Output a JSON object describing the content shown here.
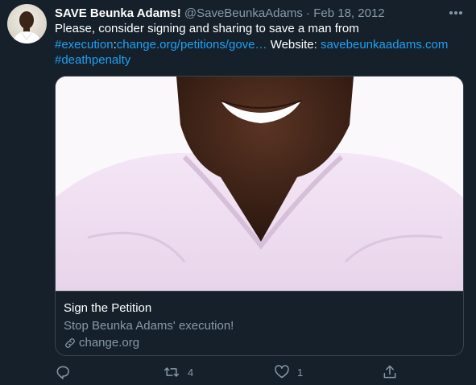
{
  "tweet": {
    "display_name": "SAVE Beunka Adams!",
    "handle": "@SaveBeunkaAdams",
    "separator": "·",
    "date": "Feb 18, 2012",
    "text_part1": "Please, consider signing and sharing to save a man from",
    "hashtag_execution": "#execution",
    "colon": ":",
    "petition_link": "change.org/petitions/gove…",
    "website_label": " Website: ",
    "website_link": "savebeunkaadams.com",
    "hashtag_deathpenalty": "#deathpenalty"
  },
  "card": {
    "title": "Sign the Petition",
    "description": "Stop Beunka Adams' execution!",
    "domain": "change.org"
  },
  "actions": {
    "retweet_count": "4",
    "like_count": "1"
  },
  "icons": {
    "more": "more-horizontal-icon",
    "reply": "reply-icon",
    "retweet": "retweet-icon",
    "like": "heart-icon",
    "share": "share-icon",
    "link": "link-icon"
  },
  "colors": {
    "background": "#15202b",
    "link": "#1da1f2",
    "muted": "#8899a6",
    "border": "#38444d"
  }
}
